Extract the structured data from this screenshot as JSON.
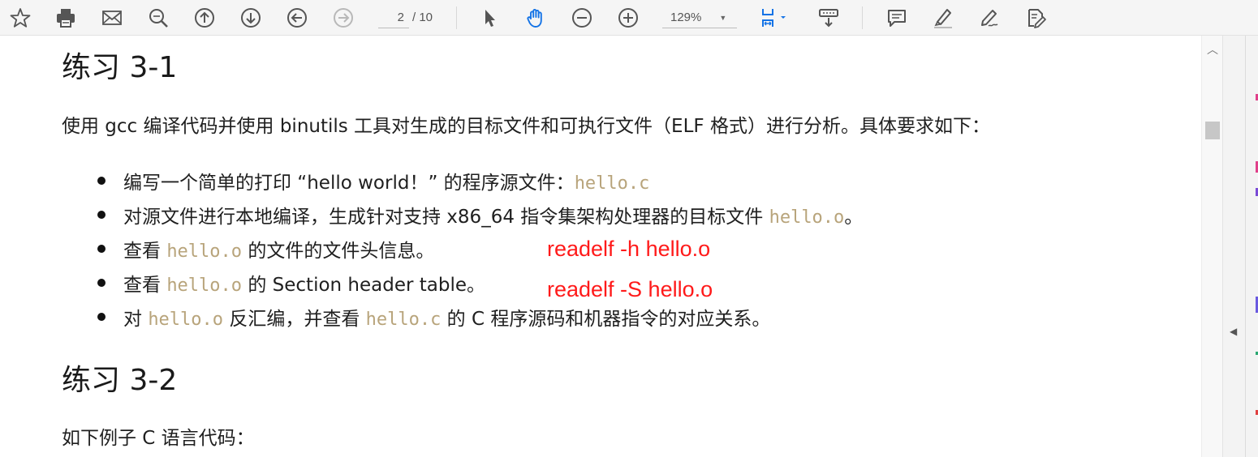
{
  "toolbar": {
    "page_current": "2",
    "page_total": "/ 10",
    "zoom": "129%",
    "icons": [
      "star-icon",
      "print-icon",
      "email-icon",
      "zoom-search-icon",
      "page-up-icon",
      "page-down-icon",
      "previous-view-icon",
      "next-view-icon",
      "select-cursor-icon",
      "hand-tool-icon",
      "zoom-out-icon",
      "zoom-in-icon",
      "fit-page-icon",
      "scroll-mode-icon",
      "comment-icon",
      "highlight-icon",
      "sign-icon",
      "fill-sign-icon"
    ]
  },
  "document": {
    "section1_title": "练习 3-1",
    "section1_intro": "使用 gcc 编译代码并使用 binutils 工具对生成的目标文件和可执行文件（ELF 格式）进行分析。具体要求如下：",
    "items": {
      "i1": {
        "a": "编写一个简单的打印 “hello world！” 的程序源文件：",
        "code1": "hello.c"
      },
      "i2": {
        "a": "对源文件进行本地编译，生成针对支持 x86_64 指令集架构处理器的目标文件 ",
        "code1": "hello.o",
        "b": "。"
      },
      "i3": {
        "a": "查看 ",
        "code1": "hello.o",
        "b": " 的文件的文件头信息。"
      },
      "i4": {
        "a": "查看 ",
        "code1": "hello.o",
        "b": " 的 Section header table。"
      },
      "i5": {
        "a": "对 ",
        "code1": "hello.o",
        "b": " 反汇编，并查看 ",
        "code2": "hello.c",
        "c": " 的 C 程序源码和机器指令的对应关系。"
      }
    },
    "annotation1": "readelf -h hello.o",
    "annotation2": "readelf -S hello.o",
    "section2_title": "练习 3-2",
    "section2_intro": "如下例子 C 语言代码："
  },
  "colors": {
    "annotation": "#ff1a1a",
    "code": "#b8a47b",
    "icon": "#555555",
    "accent_blue": "#1473e6"
  }
}
